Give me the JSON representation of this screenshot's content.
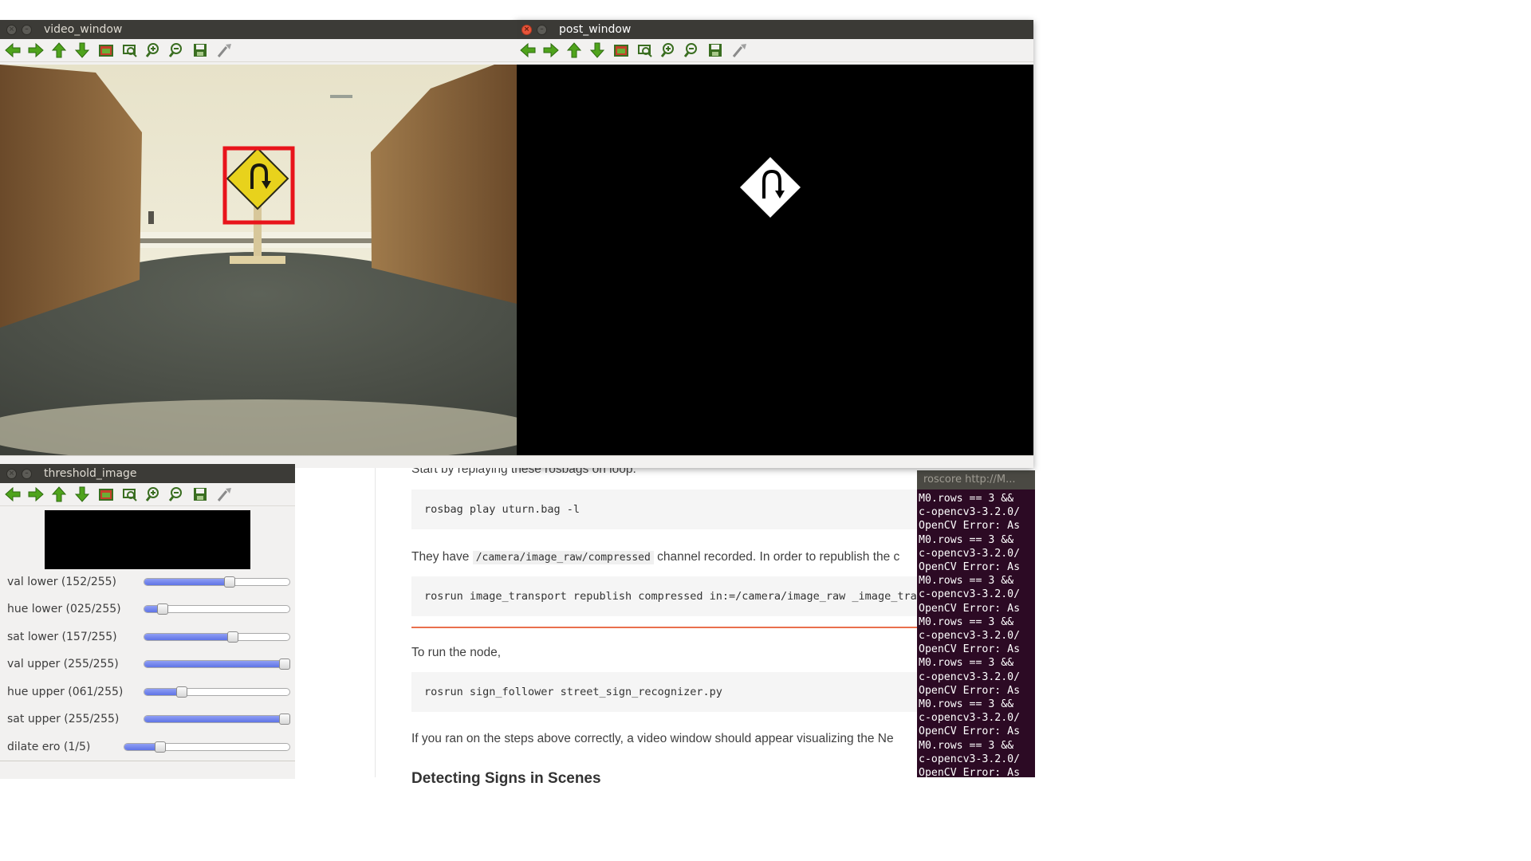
{
  "windows": {
    "video": {
      "title": "video_window"
    },
    "post": {
      "title": "post_window"
    },
    "threshold": {
      "title": "threshold_image"
    }
  },
  "toolbar_icons": [
    "arrow-left-icon",
    "arrow-right-icon",
    "arrow-up-icon",
    "arrow-down-icon",
    "image-icon",
    "zoom-fit-icon",
    "zoom-in-icon",
    "zoom-out-icon",
    "save-icon",
    "properties-icon"
  ],
  "trackbars": [
    {
      "label": "val lower",
      "value_text": "(152/255)",
      "fraction": 0.596
    },
    {
      "label": "hue lower",
      "value_text": "(025/255)",
      "fraction": 0.098
    },
    {
      "label": "sat lower",
      "value_text": "(157/255)",
      "fraction": 0.616
    },
    {
      "label": "val upper",
      "value_text": "(255/255)",
      "fraction": 1.0
    },
    {
      "label": "hue upper",
      "value_text": "(061/255)",
      "fraction": 0.239
    },
    {
      "label": "sat upper",
      "value_text": "(255/255)",
      "fraction": 1.0
    },
    {
      "label": "dilate ero",
      "value_text": "(1/5)",
      "fraction": 0.2
    }
  ],
  "doc": {
    "intro": "Start by replaying these rosbags on loop:",
    "code1": "rosbag play uturn.bag -l",
    "para2_prefix": "They have ",
    "para2_code": "/camera/image_raw/compressed",
    "para2_suffix": " channel recorded. In order to republish the c",
    "code2": "rosrun image_transport republish compressed in:=/camera/image_raw _image_tra",
    "para3": "To run the node,",
    "code3": "rosrun sign_follower street_sign_recognizer.py",
    "para4": "If you ran on the steps above correctly, a video window should appear visualizing the Ne",
    "heading_partial": "Detecting Signs in Scenes"
  },
  "terminal": {
    "title": "roscore http://M...",
    "lines": [
      "M0.rows == 3 &&",
      "c-opencv3-3.2.0/",
      "OpenCV Error: As",
      "M0.rows == 3 &&",
      "c-opencv3-3.2.0/",
      "OpenCV Error: As",
      "M0.rows == 3 &&",
      "c-opencv3-3.2.0/",
      "OpenCV Error: As",
      "M0.rows == 3 &&",
      "c-opencv3-3.2.0/",
      "OpenCV Error: As",
      "M0.rows == 3 &&",
      "c-opencv3-3.2.0/",
      "OpenCV Error: As",
      "M0.rows == 3 &&",
      "c-opencv3-3.2.0/",
      "OpenCV Error: As",
      "M0.rows == 3 &&",
      "c-opencv3-3.2.0/",
      "OpenCV Error: As"
    ]
  },
  "colors": {
    "detection_box": "#e8141b",
    "sign_yellow": "#e8d21c",
    "terminal_bg": "#2c0a24",
    "accent_rule": "#e9704d"
  }
}
